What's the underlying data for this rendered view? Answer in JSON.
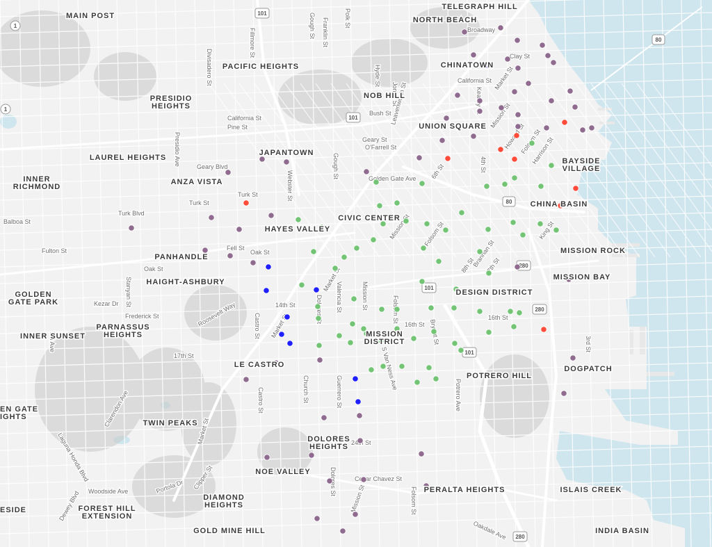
{
  "colors": {
    "water": "#cfe6ee",
    "land": "#f2f2f2",
    "point_purple": "#8f6c8f",
    "point_green": "#74c476",
    "point_blue": "#1f1fff",
    "point_red": "#ff4c3a"
  },
  "neighborhood_labels": [
    "TELEGRAPH HILL",
    "MAIN POST",
    "NORTH BEACH",
    "PACIFIC HEIGHTS",
    "CHINATOWN",
    "NOB HILL",
    "PRESIDIO HEIGHTS",
    "UNION SQUARE",
    "LAUREL HEIGHTS",
    "JAPANTOWN",
    "BAYSIDE VILLAGE",
    "INNER RICHMOND",
    "ANZA VISTA",
    "CHINA BASIN",
    "HAYES VALLEY",
    "CIVIC CENTER",
    "MISSION ROCK",
    "PANHANDLE",
    "MISSION BAY",
    "HAIGHT-ASHBURY",
    "DESIGN DISTRICT",
    "GOLDEN GATE PARK",
    "PARNASSUS HEIGHTS",
    "INNER SUNSET",
    "MISSION DISTRICT",
    "LE CASTRO",
    "DOGPATCH",
    "POTRERO HILL",
    "EN GATE IGHTS",
    "TWIN PEAKS",
    "DOLORES HEIGHTS",
    "NOE VALLEY",
    "PERALTA HEIGHTS",
    "ISLAIS CREEK",
    "DIAMOND HEIGHTS",
    "ESIDE",
    "FOREST HILL EXTENSION",
    "GOLD MINE HILL",
    "INDIA BASIN"
  ],
  "street_labels": [
    "Divisadero St",
    "Fillmore St",
    "Gough St",
    "Franklin St",
    "Polk St",
    "Broadway",
    "Clay St",
    "California St",
    "Kearny St",
    "Market St",
    "Hyde St",
    "Jones St",
    "Bush St",
    "Pine St",
    "Leavenworth St",
    "California St",
    "Geary Blvd",
    "O'Farrell St",
    "Geary St",
    "Mission St",
    "Howard St",
    "Folsom St",
    "Harrison St",
    "4th St",
    "Presidio Ave",
    "Webster St",
    "Turk St",
    "Golden Gate Ave",
    "6th St",
    "Turk Blvd",
    "Turk St",
    "Balboa St",
    "Fell St",
    "Oak St",
    "Fulton St",
    "Oak St",
    "Mission St",
    "Folsom St",
    "Brannan St",
    "King St",
    "8th St",
    "7th St",
    "Stanyan St",
    "Kezar Dr",
    "Frederick St",
    "Roosevelt Way",
    "Castro St",
    "14th St",
    "Market St",
    "Dolores St",
    "Valencia St",
    "Mission St",
    "Folsom St",
    "Bryant St",
    "16th St",
    "16th St",
    "3rd St",
    "7th Ave",
    "17th St",
    "Market St",
    "S Van Ness Ave",
    "Church St",
    "Guerrero St",
    "Potrero Ave",
    "Castro St",
    "Clarendon Ave",
    "Market St",
    "Laguna Honda Blvd",
    "24th St",
    "Dolores St",
    "Cesar Chavez St",
    "Mission St",
    "Folsom St",
    "Clipper St",
    "Portola Dr",
    "Woodside Ave",
    "Dewey Blvd",
    "Oakdale Ave",
    "Gough St"
  ],
  "highway_shields": [
    "101",
    "101",
    "101",
    "101",
    "101",
    "80",
    "80",
    "280",
    "280",
    "280",
    "1",
    "1"
  ],
  "point_categories": [
    "purple",
    "green",
    "blue",
    "red"
  ],
  "points": [
    [
      "purple",
      720,
      40
    ],
    [
      "purple",
      668,
      46
    ],
    [
      "purple",
      744,
      58
    ],
    [
      "purple",
      681,
      79
    ],
    [
      "purple",
      730,
      85
    ],
    [
      "purple",
      780,
      65
    ],
    [
      "purple",
      788,
      80
    ],
    [
      "purple",
      796,
      90
    ],
    [
      "purple",
      745,
      98
    ],
    [
      "blue",
      700,
      94
    ],
    [
      "purple",
      760,
      120
    ],
    [
      "purple",
      740,
      132
    ],
    [
      "purple",
      690,
      145
    ],
    [
      "purple",
      721,
      155
    ],
    [
      "purple",
      658,
      137
    ],
    [
      "purple",
      820,
      131
    ],
    [
      "purple",
      793,
      145
    ],
    [
      "purple",
      827,
      154
    ],
    [
      "purple",
      745,
      165
    ],
    [
      "purple",
      745,
      182
    ],
    [
      "purple",
      690,
      160
    ],
    [
      "purple",
      642,
      170
    ],
    [
      "purple",
      681,
      196
    ],
    [
      "purple",
      636,
      202
    ],
    [
      "purple",
      786,
      184
    ],
    [
      "purple",
      851,
      184
    ],
    [
      "purple",
      838,
      187
    ],
    [
      "purple",
      603,
      227
    ],
    [
      "purple",
      527,
      247
    ],
    [
      "purple",
      412,
      233
    ],
    [
      "purple",
      377,
      229
    ],
    [
      "purple",
      328,
      248
    ],
    [
      "purple",
      304,
      313
    ],
    [
      "purple",
      390,
      310
    ],
    [
      "purple",
      344,
      330
    ],
    [
      "purple",
      189,
      328
    ],
    [
      "purple",
      295,
      360
    ],
    [
      "purple",
      331,
      368
    ],
    [
      "purple",
      364,
      378
    ],
    [
      "purple",
      744,
      384
    ],
    [
      "purple",
      818,
      402
    ],
    [
      "purple",
      460,
      518
    ],
    [
      "purple",
      397,
      522
    ],
    [
      "purple",
      354,
      546
    ],
    [
      "purple",
      824,
      515
    ],
    [
      "purple",
      811,
      566
    ],
    [
      "purple",
      466,
      601
    ],
    [
      "purple",
      517,
      598
    ],
    [
      "purple",
      518,
      634
    ],
    [
      "purple",
      448,
      655
    ],
    [
      "purple",
      606,
      653
    ],
    [
      "purple",
      384,
      658
    ],
    [
      "purple",
      474,
      692
    ],
    [
      "purple",
      523,
      690
    ],
    [
      "purple",
      613,
      699
    ],
    [
      "purple",
      511,
      740
    ],
    [
      "purple",
      456,
      746
    ],
    [
      "purple",
      493,
      764
    ],
    [
      "red",
      812,
      176
    ],
    [
      "red",
      743,
      195
    ],
    [
      "red",
      720,
      215
    ],
    [
      "red",
      740,
      229
    ],
    [
      "red",
      644,
      228
    ],
    [
      "red",
      828,
      271
    ],
    [
      "red",
      806,
      296
    ],
    [
      "red",
      354,
      292
    ],
    [
      "red",
      782,
      474
    ],
    [
      "blue",
      386,
      384
    ],
    [
      "blue",
      383,
      418
    ],
    [
      "blue",
      455,
      417
    ],
    [
      "blue",
      413,
      456
    ],
    [
      "blue",
      405,
      481
    ],
    [
      "blue",
      417,
      494
    ],
    [
      "blue",
      511,
      545
    ],
    [
      "blue",
      515,
      578
    ],
    [
      "green",
      765,
      206
    ],
    [
      "green",
      793,
      238
    ],
    [
      "green",
      740,
      256
    ],
    [
      "green",
      778,
      268
    ],
    [
      "green",
      700,
      268
    ],
    [
      "green",
      726,
      265
    ],
    [
      "green",
      607,
      264
    ],
    [
      "green",
      541,
      262
    ],
    [
      "green",
      571,
      292
    ],
    [
      "green",
      546,
      296
    ],
    [
      "green",
      664,
      306
    ],
    [
      "green",
      738,
      320
    ],
    [
      "green",
      777,
      322
    ],
    [
      "green",
      800,
      331
    ],
    [
      "green",
      614,
      322
    ],
    [
      "green",
      584,
      318
    ],
    [
      "green",
      551,
      322
    ],
    [
      "green",
      429,
      316
    ],
    [
      "green",
      463,
      327
    ],
    [
      "green",
      641,
      331
    ],
    [
      "green",
      702,
      330
    ],
    [
      "green",
      752,
      338
    ],
    [
      "green",
      537,
      345
    ],
    [
      "green",
      609,
      357
    ],
    [
      "green",
      631,
      376
    ],
    [
      "green",
      690,
      362
    ],
    [
      "green",
      513,
      357
    ],
    [
      "green",
      451,
      362
    ],
    [
      "green",
      495,
      370
    ],
    [
      "green",
      482,
      386
    ],
    [
      "green",
      703,
      393
    ],
    [
      "green",
      434,
      410
    ],
    [
      "green",
      607,
      405
    ],
    [
      "green",
      656,
      416
    ],
    [
      "green",
      509,
      430
    ],
    [
      "green",
      457,
      441
    ],
    [
      "green",
      549,
      445
    ],
    [
      "green",
      571,
      445
    ],
    [
      "green",
      620,
      443
    ],
    [
      "green",
      653,
      443
    ],
    [
      "green",
      690,
      448
    ],
    [
      "green",
      734,
      448
    ],
    [
      "green",
      747,
      450
    ],
    [
      "green",
      458,
      458
    ],
    [
      "green",
      507,
      466
    ],
    [
      "green",
      523,
      473
    ],
    [
      "green",
      571,
      473
    ],
    [
      "green",
      739,
      470
    ],
    [
      "green",
      703,
      478
    ],
    [
      "green",
      624,
      477
    ],
    [
      "green",
      527,
      480
    ],
    [
      "green",
      488,
      483
    ],
    [
      "green",
      548,
      490
    ],
    [
      "green",
      595,
      487
    ],
    [
      "green",
      504,
      493
    ],
    [
      "green",
      459,
      497
    ],
    [
      "green",
      654,
      494
    ],
    [
      "green",
      663,
      504
    ],
    [
      "green",
      551,
      527
    ],
    [
      "green",
      578,
      527
    ],
    [
      "green",
      617,
      529
    ],
    [
      "green",
      534,
      532
    ],
    [
      "green",
      600,
      550
    ],
    [
      "green",
      627,
      545
    ]
  ]
}
